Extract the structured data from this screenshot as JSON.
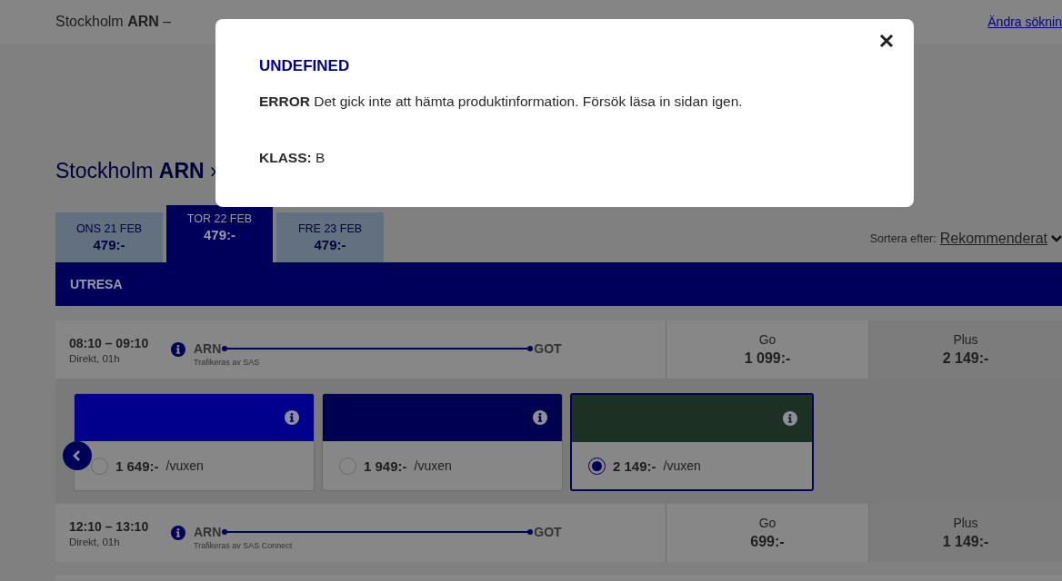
{
  "header": {
    "route": "Stockholm **ARN** –",
    "change_link": "Ändra söknin"
  },
  "route_title": "Stockholm **ARN** ›",
  "date_tabs": [
    {
      "day": "ONS 21 FEB",
      "price": "479:-",
      "selected": false
    },
    {
      "day": "TOR 22 FEB",
      "price": "479:-",
      "selected": true
    },
    {
      "day": "FRE 23 FEB",
      "price": "479:-",
      "selected": false
    }
  ],
  "sort": {
    "label": "Sortera efter:",
    "value": "Rekommenderat"
  },
  "section_title": "UTRESA",
  "flights": [
    {
      "time": "08:10 – 09:10",
      "info": "Direkt, 01h",
      "from": "ARN",
      "to": "GOT",
      "operator": "Trafikeras av SAS",
      "fares": [
        {
          "name": "Go",
          "price": "1 099:-"
        },
        {
          "name": "Plus",
          "price": "2 149:-"
        }
      ],
      "expanded": true,
      "options": [
        {
          "price": "1 649:-",
          "unit": "/vuxen",
          "selected": false,
          "color": "#00008c"
        },
        {
          "price": "1 949:-",
          "unit": "/vuxen",
          "selected": false,
          "color": "#000050"
        },
        {
          "price": "2 149:-",
          "unit": "/vuxen",
          "selected": true,
          "color": "#1c3024"
        }
      ]
    },
    {
      "time": "12:10 – 13:10",
      "info": "Direkt, 01h",
      "from": "ARN",
      "to": "GOT",
      "operator": "Trafikeras av SAS Connect",
      "fares": [
        {
          "name": "Go",
          "price": "699:-"
        },
        {
          "name": "Plus",
          "price": "1 149:-"
        }
      ],
      "expanded": false
    }
  ],
  "modal": {
    "title": "UNDEFINED",
    "message": "**ERROR** Det gick inte att hämta produktinformation. Försök läsa in sidan igen.",
    "class_line": "**KLASS:** B"
  }
}
